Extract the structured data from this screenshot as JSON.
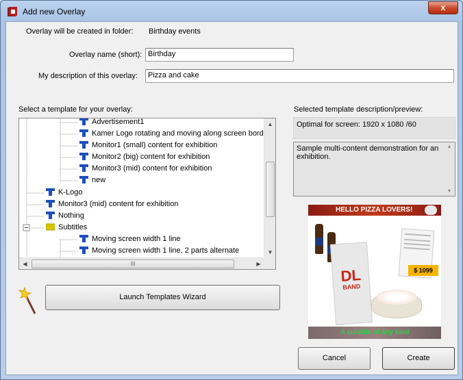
{
  "window": {
    "title": "Add new Overlay",
    "close_label": "x"
  },
  "folder": {
    "label": "Overlay will be created in folder:",
    "value": "Birthday events"
  },
  "name_field": {
    "label": "Overlay name (short):",
    "value": "Birthday"
  },
  "description_field": {
    "label": "My description of this overlay:",
    "value": "Pizza and cake"
  },
  "template_section": {
    "label": "Select a template for your overlay:"
  },
  "tree": {
    "items": [
      {
        "label": "Advertisement1"
      },
      {
        "label": "Kamer Logo rotating and moving along screen borde"
      },
      {
        "label": "Monitor1 (small) content for exhibition"
      },
      {
        "label": "Monitor2 (big) content for exhibition"
      },
      {
        "label": "Monitor3 (mid) content for exhibition"
      },
      {
        "label": "new"
      },
      {
        "label": "K-Logo"
      },
      {
        "label": "Monitor3 (mid) content for exhibition"
      },
      {
        "label": "Nothing"
      },
      {
        "label": "Subtitles"
      },
      {
        "label": "Moving screen width 1 line"
      },
      {
        "label": "Moving screen width 1 line, 2 parts alternate"
      }
    ],
    "scroll_grip": "III",
    "scroll_up": "▲",
    "scroll_down": "▼",
    "scroll_left": "◀",
    "scroll_right": "▶",
    "collapse_marker": "−"
  },
  "wizard_button": {
    "label": "Launch Templates Wizard"
  },
  "preview_section": {
    "label": "Selected template description/preview:",
    "screen_info": "Optimal for screen: 1920 x 1080 /60",
    "description": "Sample multi-content demonstration for an exhibition."
  },
  "preview_image": {
    "banner": "HELLO PIZZA LOVERS!",
    "price": "$ 1099",
    "card_title": "DL",
    "card_sub": "BAND",
    "subtitle": "A subtitle of any kind"
  },
  "buttons": {
    "cancel": "Cancel",
    "create": "Create"
  },
  "colors": {
    "window_frame": "#a9c4e6",
    "client_bg": "#f0f0f0",
    "close_red": "#c94b2c",
    "tree_icon_blue": "#1d4fbf",
    "folder_yellow": "#d8c400"
  }
}
